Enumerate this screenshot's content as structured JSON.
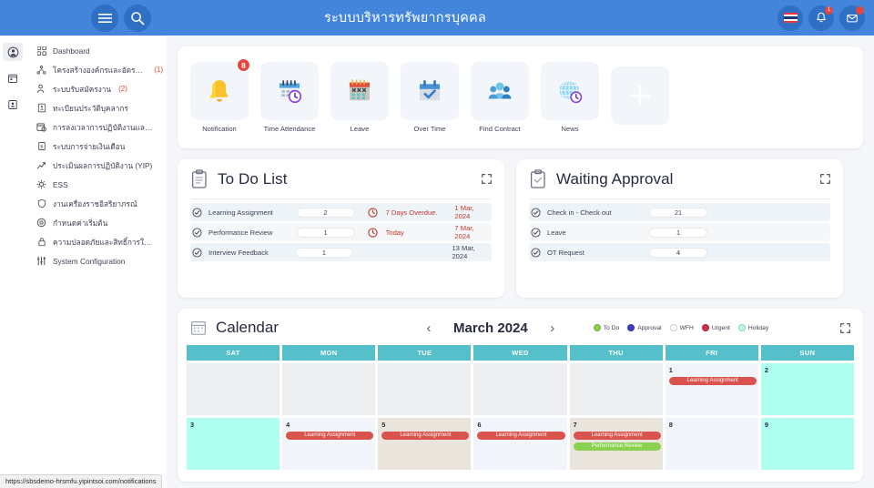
{
  "header": {
    "title": "ระบบบริหารทรัพยากรบุคคล",
    "menu_icon": "hamburger-icon",
    "search_icon": "search-icon",
    "flag_icon": "thai-flag-icon",
    "bell_badge": "1",
    "mail_badge": "",
    "accent": "#4285db"
  },
  "rail": {
    "items": [
      {
        "icon": "user-circle-icon",
        "active": true
      },
      {
        "icon": "calendar-icon",
        "active": false
      },
      {
        "icon": "id-card-icon",
        "active": false
      }
    ]
  },
  "sidebar": {
    "items": [
      {
        "label": "Dashboard",
        "count": "",
        "icon": "grid-icon"
      },
      {
        "label": "โครงสร้างองค์กรและอัตรากำลัง",
        "count": "(1)",
        "icon": "org-chart-icon"
      },
      {
        "label": "ระบบรับสมัครงาน",
        "count": "(2)",
        "icon": "person-add-icon"
      },
      {
        "label": "ทะเบียนประวัติบุคลากร",
        "count": "",
        "icon": "profile-record-icon"
      },
      {
        "label": "การลงเวลาการปฏิบัติงานและการ...",
        "count": "",
        "icon": "timesheet-icon"
      },
      {
        "label": "ระบบการจ่ายเงินเดือน",
        "count": "",
        "icon": "payroll-icon"
      },
      {
        "label": "ประเมินผลการปฏิบัติงาน (YIP)",
        "count": "",
        "icon": "trend-up-icon"
      },
      {
        "label": "ESS",
        "count": "",
        "icon": "ess-icon"
      },
      {
        "label": "งานเครื่องราชอิสริยาภรณ์",
        "count": "",
        "icon": "shield-icon"
      },
      {
        "label": "กำหนดค่าเริ่มต้น",
        "count": "",
        "icon": "gear-icon"
      },
      {
        "label": "ความปลอดภัยและสิทธิ์การใช้งาน",
        "count": "",
        "icon": "lock-icon"
      },
      {
        "label": "System Configuration",
        "count": "",
        "icon": "sliders-icon"
      }
    ]
  },
  "tiles": [
    {
      "label": "Notification",
      "icon": "bell-icon",
      "badge": "8"
    },
    {
      "label": "Time Attendance",
      "icon": "calendar-clock-icon",
      "badge": ""
    },
    {
      "label": "Leave",
      "icon": "calendar-x-icon",
      "badge": ""
    },
    {
      "label": "Over Time",
      "icon": "calendar-check-icon",
      "badge": ""
    },
    {
      "label": "Find Contract",
      "icon": "people-icon",
      "badge": ""
    },
    {
      "label": "News",
      "icon": "globe-clock-icon",
      "badge": ""
    },
    {
      "label": "",
      "icon": "plus-icon",
      "badge": ""
    }
  ],
  "todo": {
    "title": "To Do List",
    "icon": "clipboard-icon",
    "expand_icon": "expand-icon",
    "rows": [
      {
        "name": "Learning Assignment",
        "count": "2",
        "status": "7 Days Overdue.",
        "date": "1 Mar, 2024",
        "overdue": true
      },
      {
        "name": "Performance Review",
        "count": "1",
        "status": "Today",
        "date": "7 Mar, 2024",
        "overdue": true
      },
      {
        "name": "Interview Feedback",
        "count": "1",
        "status": "",
        "date": "13 Mar, 2024",
        "overdue": false
      }
    ]
  },
  "approval": {
    "title": "Waiting Approval",
    "icon": "clipboard-check-icon",
    "expand_icon": "expand-icon",
    "rows": [
      {
        "name": "Check in - Check out",
        "count": "21"
      },
      {
        "name": "Leave",
        "count": "1"
      },
      {
        "name": "OT Request",
        "count": "4"
      }
    ]
  },
  "calendar": {
    "title": "Calendar",
    "icon": "calendar-grid-icon",
    "month": "March 2024",
    "prev_icon": "chevron-left-icon",
    "next_icon": "chevron-right-icon",
    "expand_icon": "expand-icon",
    "legend": [
      {
        "label": "To Do",
        "color": "#8bd14f"
      },
      {
        "label": "Approval",
        "color": "#3b3ec4"
      },
      {
        "label": "WFH",
        "color": "#ffffff"
      },
      {
        "label": "Urgent",
        "color": "#cc3344"
      },
      {
        "label": "Holiday",
        "color": "#affff0"
      }
    ],
    "dow": [
      "SAT",
      "MON",
      "TUE",
      "WED",
      "THU",
      "FRI",
      "SUN"
    ],
    "weeks": [
      [
        {
          "day": "",
          "type": "blank",
          "events": []
        },
        {
          "day": "",
          "type": "blank",
          "events": []
        },
        {
          "day": "",
          "type": "blank",
          "events": []
        },
        {
          "day": "",
          "type": "blank",
          "events": []
        },
        {
          "day": "",
          "type": "blank",
          "events": []
        },
        {
          "day": "1",
          "type": "normal",
          "events": [
            {
              "label": "Learning Assignment",
              "kind": "urgent"
            }
          ]
        },
        {
          "day": "2",
          "type": "holiday",
          "events": []
        }
      ],
      [
        {
          "day": "3",
          "type": "holiday",
          "events": []
        },
        {
          "day": "4",
          "type": "normal",
          "events": [
            {
              "label": "Learning Assignment",
              "kind": "urgent"
            }
          ]
        },
        {
          "day": "5",
          "type": "today",
          "events": [
            {
              "label": "Learning Assignment",
              "kind": "urgent"
            }
          ]
        },
        {
          "day": "6",
          "type": "normal",
          "events": [
            {
              "label": "Learning Assignment",
              "kind": "urgent"
            }
          ]
        },
        {
          "day": "7",
          "type": "today",
          "events": [
            {
              "label": "Learning Assignment",
              "kind": "urgent"
            },
            {
              "label": "Performance Review",
              "kind": "todo"
            }
          ]
        },
        {
          "day": "8",
          "type": "normal",
          "events": []
        },
        {
          "day": "9",
          "type": "holiday",
          "events": []
        }
      ]
    ]
  },
  "statusbar": {
    "url": "https://sbsdemo-hrsmfu.yipintsoi.com/notifications"
  }
}
